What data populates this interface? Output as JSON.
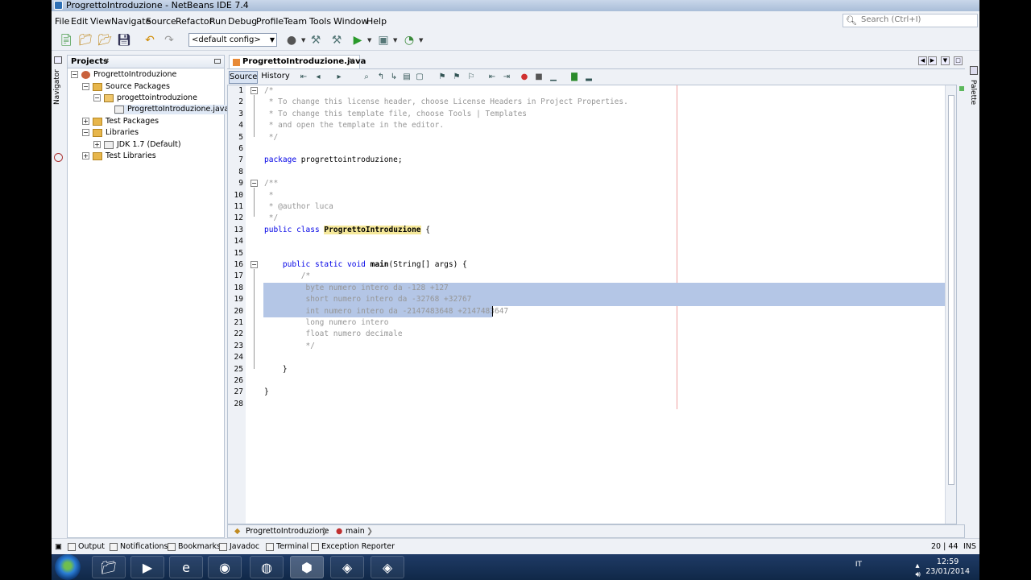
{
  "window": {
    "title": "ProgrettoIntroduzione - NetBeans IDE 7.4"
  },
  "menu": [
    "File",
    "Edit",
    "View",
    "Navigate",
    "Source",
    "Refactor",
    "Run",
    "Debug",
    "Profile",
    "Team",
    "Tools",
    "Window",
    "Help"
  ],
  "search": {
    "placeholder": "Search (Ctrl+I)"
  },
  "toolbar": {
    "config": "<default config>"
  },
  "left_strip": {
    "navigator": "Navigator"
  },
  "projects": {
    "title": "Projects",
    "tree": {
      "project": "ProgrettoIntroduzione",
      "source_packages": "Source Packages",
      "package": "progettointroduzione",
      "file": "ProgrettoIntroduzione.java",
      "test_packages": "Test Packages",
      "libraries": "Libraries",
      "jdk": "JDK 1.7 (Default)",
      "test_libraries": "Test Libraries"
    }
  },
  "editor": {
    "tab": "ProgrettoIntroduzione.java",
    "source": "Source",
    "history": "History",
    "lines": [
      "/*",
      " * To change this license header, choose License Headers in Project Properties.",
      " * To change this template file, choose Tools | Templates",
      " * and open the template in the editor.",
      " */",
      "",
      "package progrettointroduzione;",
      "",
      "/**",
      " *",
      " * @author luca",
      " */",
      "public class ProgrettoIntroduzione {",
      "",
      "",
      "    public static void main(String[] args) {",
      "        /*",
      "         byte numero intero da -128 +127",
      "         short numero intero da -32768 +32767",
      "         int numero intero da -2147483648 +2147483647",
      "         long numero intero",
      "         float numero decimale",
      "         */",
      "",
      "    }",
      "",
      "}",
      ""
    ],
    "line_numbers": [
      "1",
      "2",
      "3",
      "4",
      "5",
      "6",
      "7",
      "8",
      "9",
      "10",
      "11",
      "12",
      "13",
      "14",
      "15",
      "16",
      "17",
      "18",
      "19",
      "20",
      "21",
      "22",
      "23",
      "24",
      "25",
      "26",
      "27",
      "28"
    ],
    "breadcrumb": {
      "class": "ProgrettoIntroduzione",
      "method": "main"
    }
  },
  "right_strip": {
    "palette": "Palette"
  },
  "status": {
    "items": [
      "Output",
      "Notifications",
      "Bookmarks",
      "Javadoc",
      "Terminal",
      "Exception Reporter"
    ],
    "position": "20 | 44",
    "mode": "INS"
  },
  "taskbar": {
    "lang": "IT",
    "time": "12:59",
    "date": "23/01/2014"
  }
}
